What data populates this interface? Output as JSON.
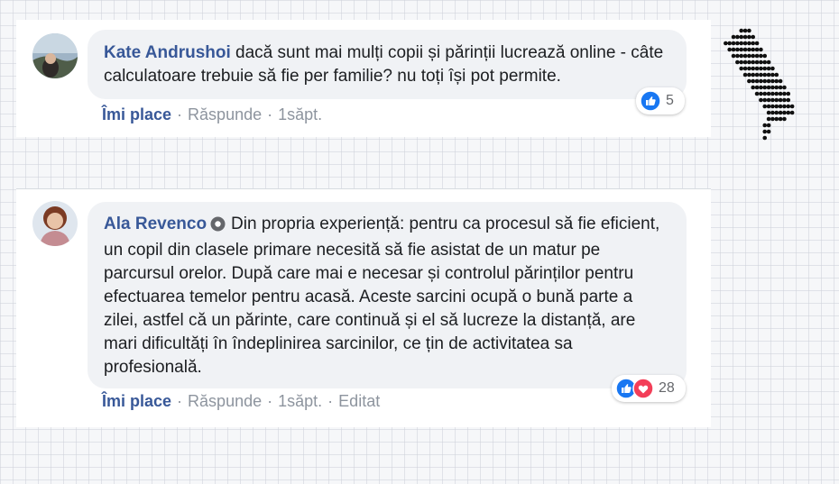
{
  "comments": [
    {
      "author": "Kate Andrushoi",
      "text": "dacă sunt mai mulți copii și părinții lucrează online - câte calculatoare trebuie să fie per familie? nu toți își pot permite.",
      "actions": {
        "like": "Îmi place",
        "reply": "Răspunde",
        "time": "1săpt."
      },
      "reactions": {
        "count": "5",
        "icons": [
          "like-icon"
        ]
      }
    },
    {
      "author": "Ala Revenco",
      "text": "Din propria experiență: pentru ca procesul să fie eficient, un copil din clasele primare necesită să fie asistat de un matur pe parcursul orelor. După care mai e necesar și controlul părinților pentru efectuarea temelor pentru acasă. Aceste sarcini ocupă o bună parte a zilei, astfel că un părinte, care continuă și el să lucreze la distanță, are mari dificultăți în îndeplinirea sarcinilor, ce țin de activitatea sa profesională.",
      "actions": {
        "like": "Îmi place",
        "reply": "Răspunde",
        "time": "1săpt.",
        "edited": "Editat"
      },
      "reactions": {
        "count": "28",
        "icons": [
          "like-icon",
          "love-icon"
        ]
      }
    }
  ],
  "colors": {
    "author": "#385898",
    "like_blue": "#1877f2",
    "love_red": "#f33e58",
    "bubble": "#f0f2f5"
  }
}
